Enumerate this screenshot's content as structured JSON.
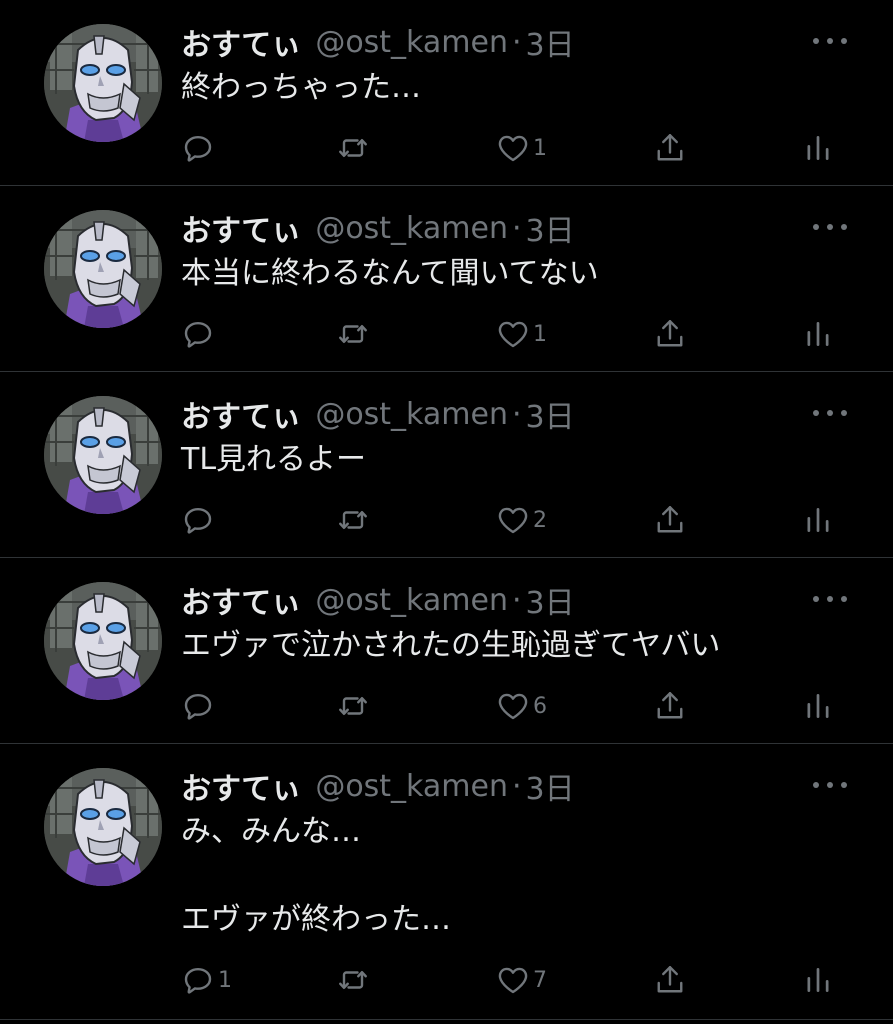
{
  "colors": {
    "background": "#000000",
    "text": "#e7e9ea",
    "muted": "#71767b",
    "divider": "#2f3336"
  },
  "icons": {
    "reply": "reply-icon",
    "retweet": "retweet-icon",
    "like": "heart-icon",
    "share": "share-icon",
    "stats": "stats-icon",
    "more": "more-icon"
  },
  "tweets": [
    {
      "name": "おすてぃ",
      "handle": "@ost_kamen",
      "sep": "·",
      "time": "3日",
      "text": "終わっちゃった…",
      "replies": "",
      "retweets": "",
      "likes": "1"
    },
    {
      "name": "おすてぃ",
      "handle": "@ost_kamen",
      "sep": "·",
      "time": "3日",
      "text": "本当に終わるなんて聞いてない",
      "replies": "",
      "retweets": "",
      "likes": "1"
    },
    {
      "name": "おすてぃ",
      "handle": "@ost_kamen",
      "sep": "·",
      "time": "3日",
      "text": "TL見れるよー",
      "replies": "",
      "retweets": "",
      "likes": "2"
    },
    {
      "name": "おすてぃ",
      "handle": "@ost_kamen",
      "sep": "·",
      "time": "3日",
      "text": "エヴァで泣かされたの生恥過ぎてヤバい",
      "replies": "",
      "retweets": "",
      "likes": "6"
    },
    {
      "name": "おすてぃ",
      "handle": "@ost_kamen",
      "sep": "·",
      "time": "3日",
      "text": "み、みんな…\n\nエヴァが終わった…",
      "replies": "1",
      "retweets": "",
      "likes": "7"
    }
  ]
}
